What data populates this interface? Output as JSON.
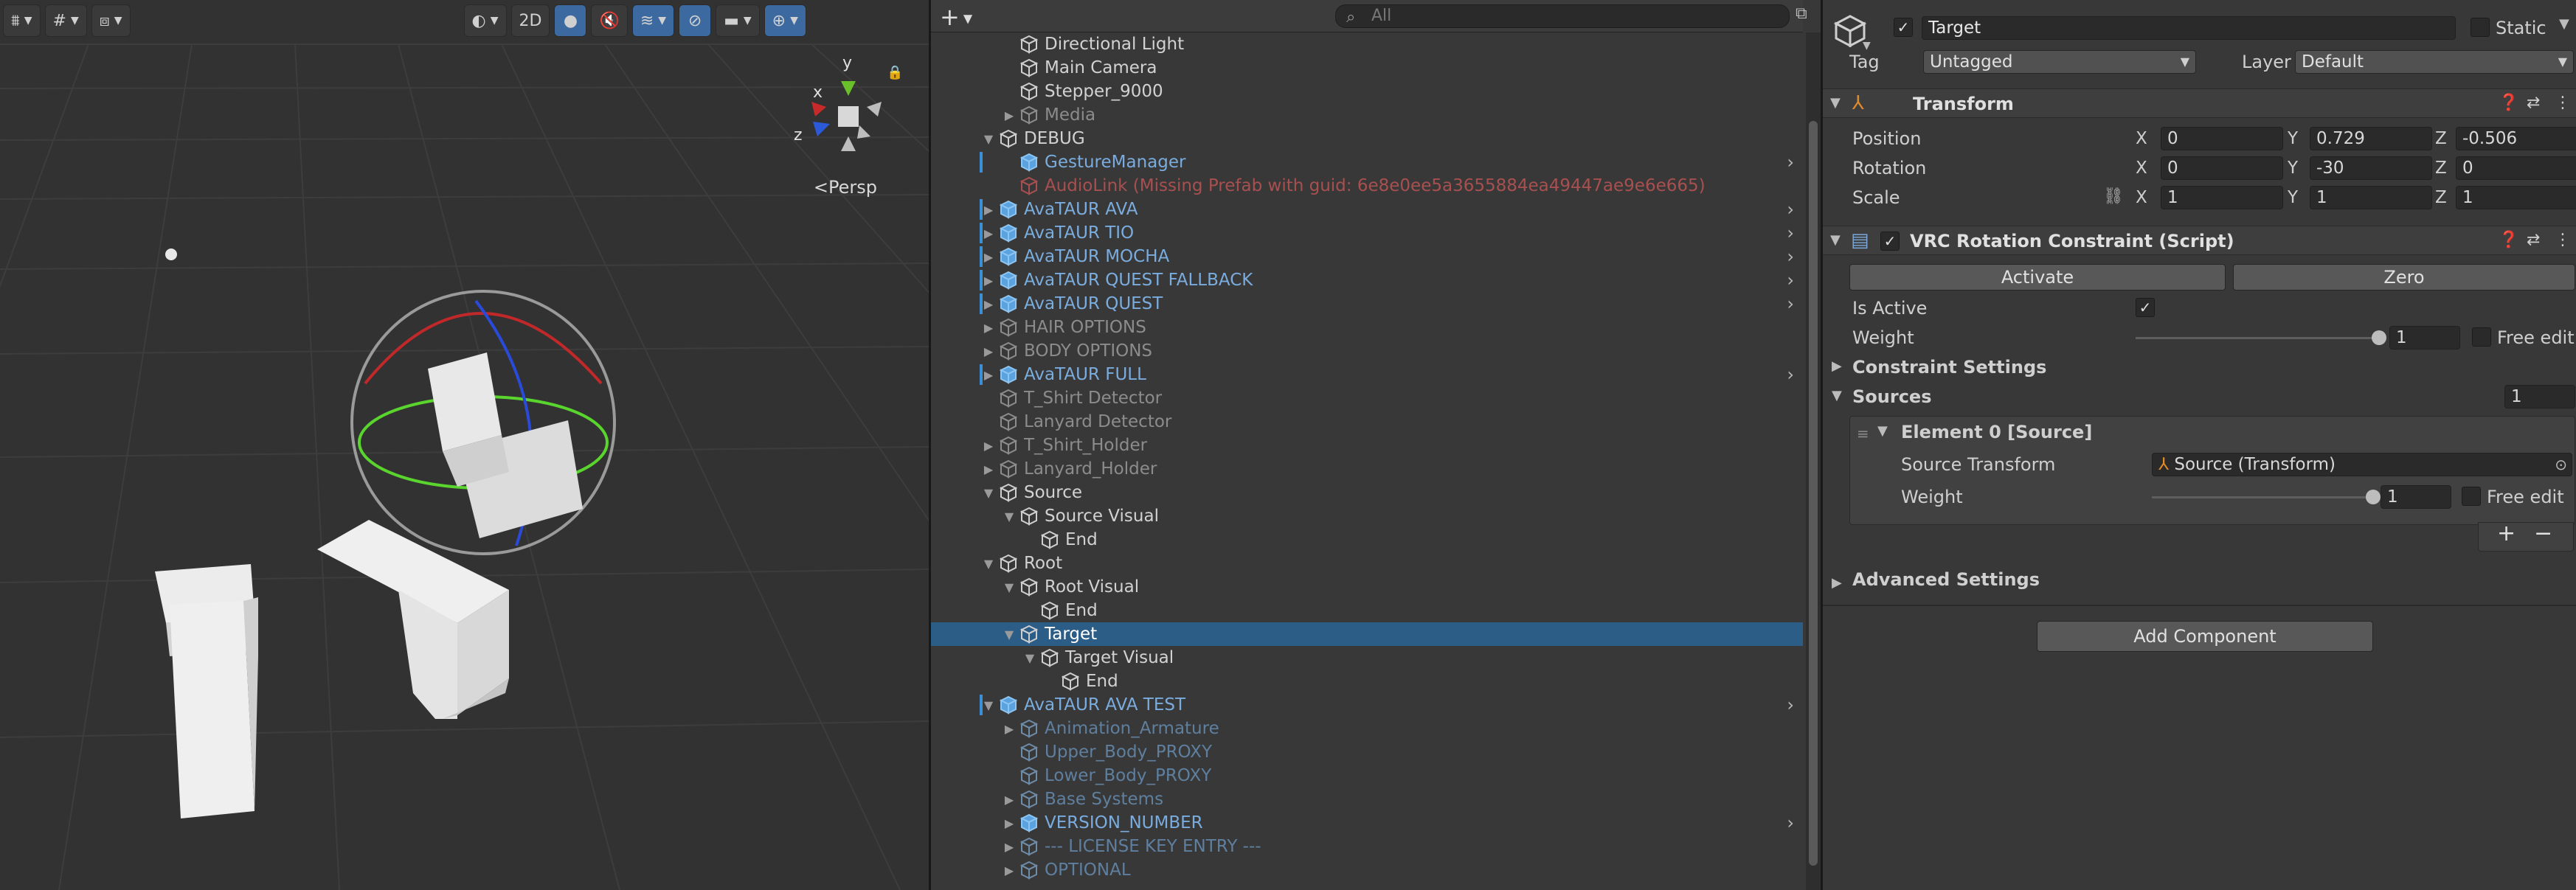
{
  "scene": {
    "persp_label": "Persp",
    "toolbar": {
      "btn_2d": "2D"
    },
    "gizmo": {
      "x_label": "x",
      "y_label": "y",
      "z_label": "z"
    }
  },
  "hierarchy": {
    "add_label": "+",
    "search_placeholder": "All",
    "rows": [
      {
        "label": "Directional Light",
        "depth": 2,
        "arrow": "",
        "color": "normal",
        "icon": "cube"
      },
      {
        "label": "Main Camera",
        "depth": 2,
        "arrow": "",
        "color": "normal",
        "icon": "cube"
      },
      {
        "label": "Stepper_9000",
        "depth": 2,
        "arrow": "",
        "color": "normal",
        "icon": "cube"
      },
      {
        "label": "Media",
        "depth": 2,
        "arrow": "right",
        "color": "dim",
        "icon": "cube"
      },
      {
        "label": "DEBUG",
        "depth": 1,
        "arrow": "down",
        "color": "normal",
        "icon": "cube"
      },
      {
        "label": "GestureManager",
        "depth": 2,
        "arrow": "",
        "color": "prefab",
        "icon": "prefab",
        "bar": true,
        "chev": true
      },
      {
        "label": "AudioLink (Missing Prefab with guid: 6e8e0ee5a3655884ea49447ae9e6e665)",
        "depth": 2,
        "arrow": "",
        "color": "missing",
        "icon": "missing"
      },
      {
        "label": "AvaTAUR AVA",
        "depth": 1,
        "arrow": "right",
        "color": "prefab",
        "icon": "prefab",
        "bar": true,
        "chev": true
      },
      {
        "label": "AvaTAUR TIO",
        "depth": 1,
        "arrow": "right",
        "color": "prefab",
        "icon": "prefab",
        "bar": true,
        "chev": true
      },
      {
        "label": "AvaTAUR MOCHA",
        "depth": 1,
        "arrow": "right",
        "color": "prefab",
        "icon": "prefab",
        "bar": true,
        "chev": true
      },
      {
        "label": "AvaTAUR QUEST FALLBACK",
        "depth": 1,
        "arrow": "right",
        "color": "prefab",
        "icon": "prefab",
        "bar": true,
        "chev": true
      },
      {
        "label": "AvaTAUR QUEST",
        "depth": 1,
        "arrow": "right",
        "color": "prefab",
        "icon": "prefab",
        "bar": true,
        "chev": true
      },
      {
        "label": "HAIR OPTIONS",
        "depth": 1,
        "arrow": "right",
        "color": "dim",
        "icon": "cube"
      },
      {
        "label": "BODY OPTIONS",
        "depth": 1,
        "arrow": "right",
        "color": "dim",
        "icon": "cube"
      },
      {
        "label": "AvaTAUR FULL",
        "depth": 1,
        "arrow": "right",
        "color": "prefab",
        "icon": "prefab",
        "bar": true,
        "chev": true
      },
      {
        "label": "T_Shirt Detector",
        "depth": 1,
        "arrow": "",
        "color": "dim",
        "icon": "cube"
      },
      {
        "label": "Lanyard Detector",
        "depth": 1,
        "arrow": "",
        "color": "dim",
        "icon": "cube"
      },
      {
        "label": "T_Shirt_Holder",
        "depth": 1,
        "arrow": "right",
        "color": "dim",
        "icon": "cube"
      },
      {
        "label": "Lanyard_Holder",
        "depth": 1,
        "arrow": "right",
        "color": "dim",
        "icon": "cube"
      },
      {
        "label": "Source",
        "depth": 1,
        "arrow": "down",
        "color": "normal",
        "icon": "cube"
      },
      {
        "label": "Source Visual",
        "depth": 2,
        "arrow": "down",
        "color": "normal",
        "icon": "cube"
      },
      {
        "label": "End",
        "depth": 3,
        "arrow": "",
        "color": "normal",
        "icon": "cube"
      },
      {
        "label": "Root",
        "depth": 1,
        "arrow": "down",
        "color": "normal",
        "icon": "cube"
      },
      {
        "label": "Root Visual",
        "depth": 2,
        "arrow": "down",
        "color": "normal",
        "icon": "cube"
      },
      {
        "label": "End",
        "depth": 3,
        "arrow": "",
        "color": "normal",
        "icon": "cube"
      },
      {
        "label": "Target",
        "depth": 2,
        "arrow": "down",
        "color": "normal",
        "icon": "cube",
        "selected": true
      },
      {
        "label": "Target Visual",
        "depth": 3,
        "arrow": "down",
        "color": "normal",
        "icon": "cube"
      },
      {
        "label": "End",
        "depth": 4,
        "arrow": "",
        "color": "normal",
        "icon": "cube"
      },
      {
        "label": "AvaTAUR AVA TEST",
        "depth": 1,
        "arrow": "down",
        "color": "prefab",
        "icon": "prefab",
        "bar": true,
        "chev": true
      },
      {
        "label": "Animation_Armature",
        "depth": 2,
        "arrow": "right",
        "color": "prefab-dim",
        "icon": "cube"
      },
      {
        "label": "Upper_Body_PROXY",
        "depth": 2,
        "arrow": "",
        "color": "prefab-dim",
        "icon": "cube"
      },
      {
        "label": "Lower_Body_PROXY",
        "depth": 2,
        "arrow": "",
        "color": "prefab-dim",
        "icon": "cube"
      },
      {
        "label": "Base Systems",
        "depth": 2,
        "arrow": "right",
        "color": "prefab-dim",
        "icon": "cube"
      },
      {
        "label": "VERSION_NUMBER",
        "depth": 2,
        "arrow": "right",
        "color": "prefab",
        "icon": "prefab",
        "chev": true
      },
      {
        "label": "--- LICENSE KEY ENTRY ---",
        "depth": 2,
        "arrow": "right",
        "color": "prefab-dim",
        "icon": "cube"
      },
      {
        "label": "OPTIONAL",
        "depth": 2,
        "arrow": "right",
        "color": "prefab-dim",
        "icon": "cube"
      }
    ]
  },
  "inspector": {
    "object_name": "Target",
    "static_label": "Static",
    "tag_label": "Tag",
    "tag_value": "Untagged",
    "layer_label": "Layer",
    "layer_value": "Default",
    "transform": {
      "title": "Transform",
      "position_label": "Position",
      "rotation_label": "Rotation",
      "scale_label": "Scale",
      "x": "X",
      "y": "Y",
      "z": "Z",
      "position": {
        "x": "0",
        "y": "0.729",
        "z": "-0.506"
      },
      "rotation": {
        "x": "0",
        "y": "-30",
        "z": "0"
      },
      "scale": {
        "x": "1",
        "y": "1",
        "z": "1"
      }
    },
    "constraint": {
      "title": "VRC Rotation Constraint (Script)",
      "activate_label": "Activate",
      "zero_label": "Zero",
      "is_active_label": "Is Active",
      "weight_label": "Weight",
      "weight_value": "1",
      "weight_fraction": 1.0,
      "free_edit_label": "Free edit",
      "constraint_settings_label": "Constraint Settings",
      "sources_label": "Sources",
      "sources_count": "1",
      "element_label": "Element 0 [Source]",
      "source_transform_label": "Source Transform",
      "source_transform_value": "Source (Transform)",
      "element_weight_label": "Weight",
      "element_weight_value": "1",
      "element_free_edit_label": "Free edit",
      "plus_label": "+",
      "minus_label": "−",
      "advanced_settings_label": "Advanced Settings"
    },
    "add_component_label": "Add Component"
  }
}
